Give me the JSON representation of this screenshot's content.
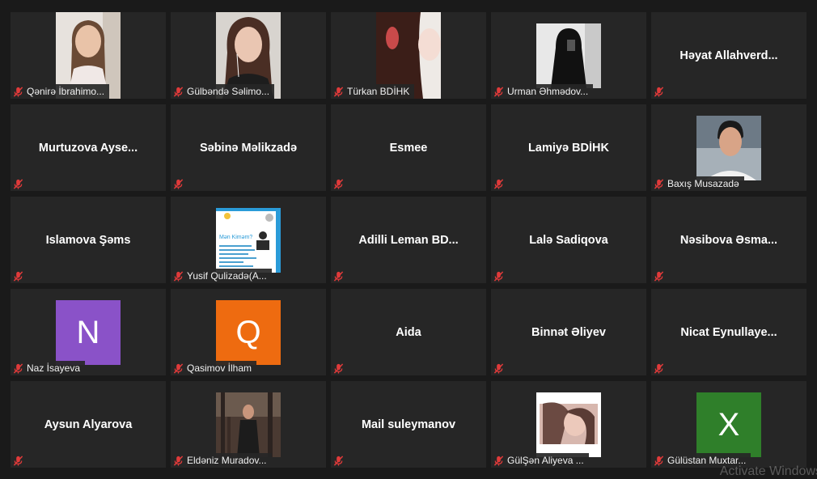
{
  "tiles": [
    {
      "name": "Qənirə İbrahimo...",
      "type": "video",
      "visual": "girl-braids"
    },
    {
      "name": "Gülbəndə Səlimo...",
      "type": "video",
      "visual": "girl-earphones"
    },
    {
      "name": "Türkan BDİHK",
      "type": "video",
      "visual": "girl-curly"
    },
    {
      "name": "Urman Əhmədov...",
      "type": "photo",
      "visual": "hooded-figure"
    },
    {
      "name": "Həyat  Allahverd...",
      "type": "name"
    },
    {
      "name": "Murtuzova  Ayse...",
      "type": "name"
    },
    {
      "name": "Səbinə Məlikzadə",
      "type": "name"
    },
    {
      "name": "Esmee",
      "type": "name"
    },
    {
      "name": "Lamiyə BDİHK",
      "type": "name"
    },
    {
      "name": "Baxış Musazadə",
      "type": "photo",
      "visual": "young-man"
    },
    {
      "name": "Islamova Şəms",
      "type": "name"
    },
    {
      "name": "Yusif Qulizadə(A...",
      "type": "photo",
      "visual": "poster",
      "poster_title": "Mən Kiməm?"
    },
    {
      "name": "Adilli  Leman  BD...",
      "type": "name"
    },
    {
      "name": "Lalə Sadiqova",
      "type": "name"
    },
    {
      "name": "Nəsibova  Əsma...",
      "type": "name"
    },
    {
      "name": "Naz İsayeva",
      "type": "avatar",
      "initial": "N",
      "color": "#8a52c8"
    },
    {
      "name": "Qasimov İlham",
      "type": "avatar",
      "initial": "Q",
      "color": "#ee6b10"
    },
    {
      "name": "Aida",
      "type": "name"
    },
    {
      "name": "Binnət Əliyev",
      "type": "name"
    },
    {
      "name": "Nicat  Eynullaye...",
      "type": "name"
    },
    {
      "name": "Aysun Alyarova",
      "type": "name"
    },
    {
      "name": "Eldəniz Muradov...",
      "type": "photo",
      "visual": "man-forest"
    },
    {
      "name": "Mail suleymanov",
      "type": "name"
    },
    {
      "name": "GülŞən Aliyeva ...",
      "type": "photo",
      "visual": "girl-portrait"
    },
    {
      "name": "Gülüstan Muxtar...",
      "type": "avatar",
      "initial": "X",
      "color": "#2f7f2a"
    }
  ],
  "watermark": "Activate Windows"
}
